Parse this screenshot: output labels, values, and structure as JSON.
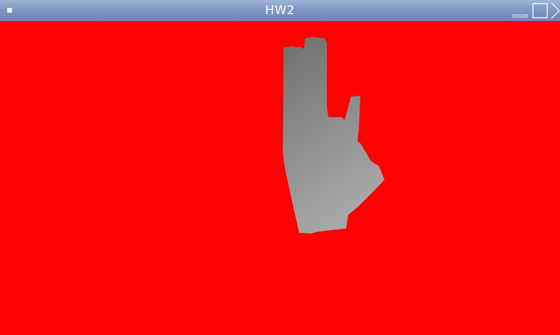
{
  "window": {
    "title": "HW2"
  },
  "icons": {
    "menu": "window-menu-icon",
    "minimize": "minimize-icon",
    "maximize": "maximize-icon",
    "close": "close-icon"
  },
  "colors": {
    "titlebar_top": "#9fb4d6",
    "titlebar_bottom": "#6a86b8",
    "canvas_background": "#ff0000",
    "hand_shade_dark": "#6e6e6e",
    "hand_shade_light": "#a8a8a8"
  }
}
